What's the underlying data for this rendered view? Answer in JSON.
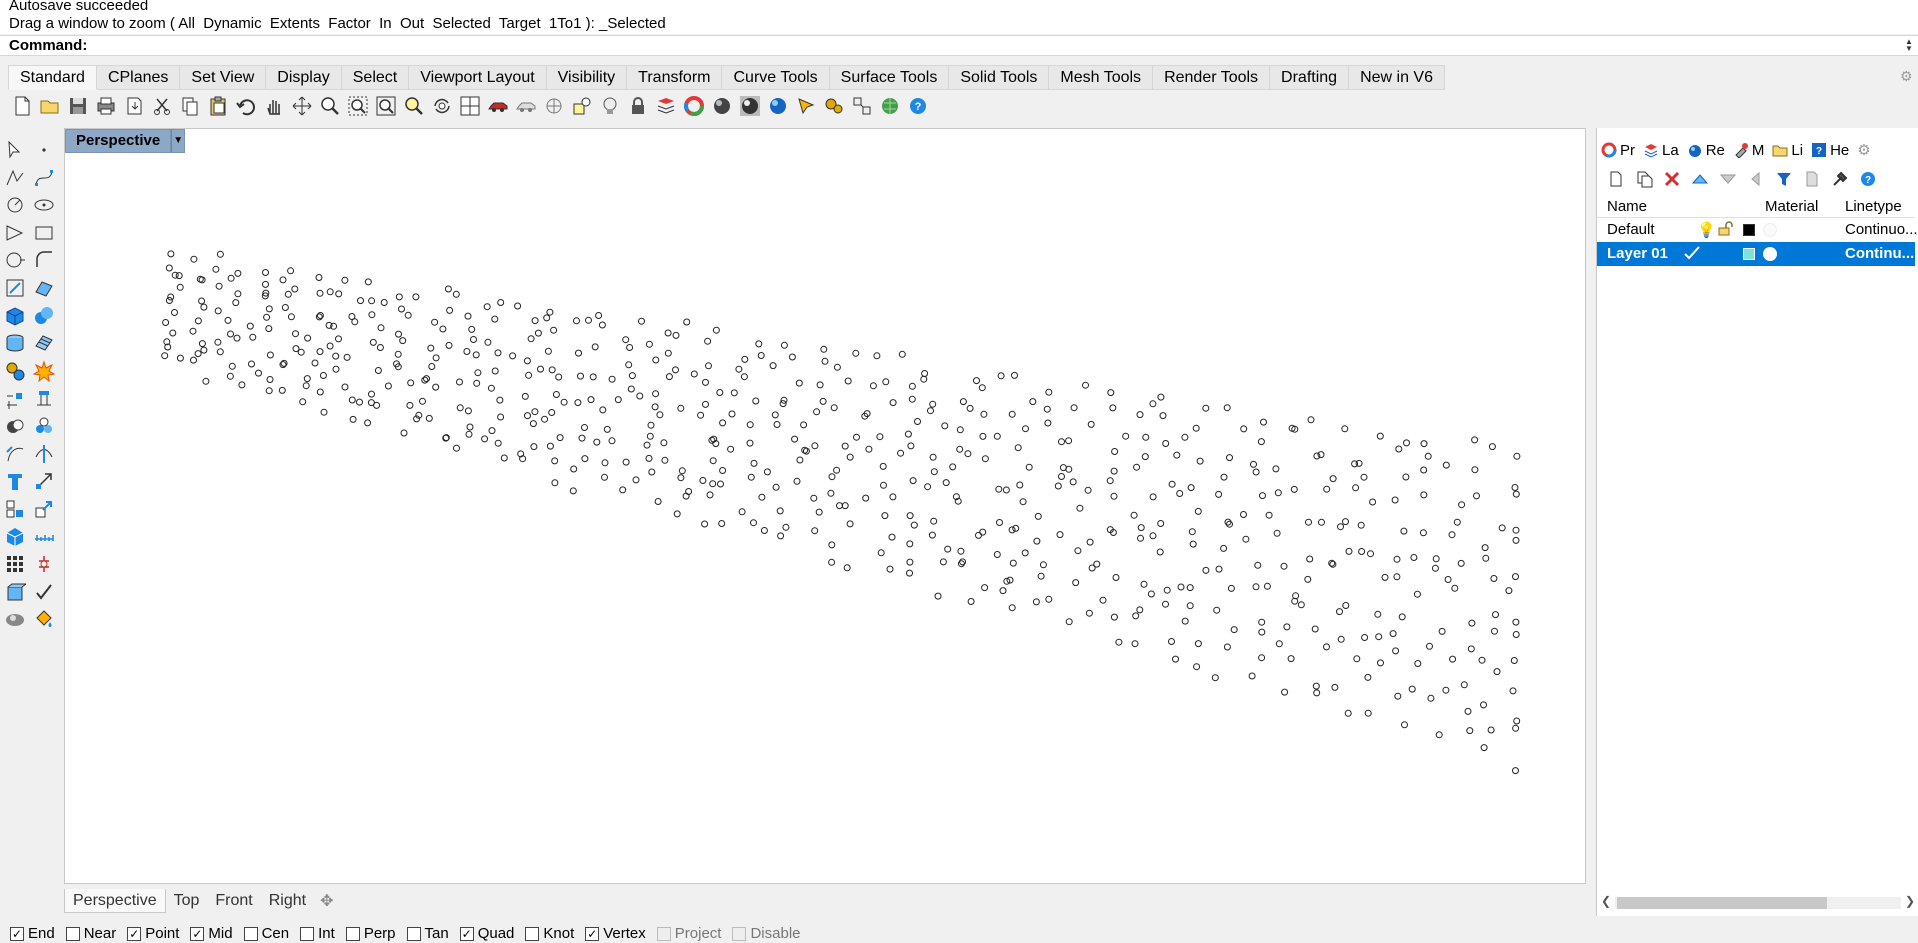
{
  "command": {
    "history": [
      "Autosave succeeded",
      "Drag a window to zoom ( All  Dynamic  Extents  Factor  In  Out  Selected  Target  1To1 ): _Selected"
    ],
    "prompt_label": "Command:",
    "input_value": ""
  },
  "tabs": [
    "Standard",
    "CPlanes",
    "Set View",
    "Display",
    "Select",
    "Viewport Layout",
    "Visibility",
    "Transform",
    "Curve Tools",
    "Surface Tools",
    "Solid Tools",
    "Mesh Tools",
    "Render Tools",
    "Drafting",
    "New in V6"
  ],
  "active_tab": "Standard",
  "viewport": {
    "title": "Perspective",
    "tabs": [
      "Perspective",
      "Top",
      "Front",
      "Right"
    ],
    "active": "Perspective"
  },
  "osnap": [
    {
      "label": "End",
      "checked": true
    },
    {
      "label": "Near",
      "checked": false
    },
    {
      "label": "Point",
      "checked": true
    },
    {
      "label": "Mid",
      "checked": true
    },
    {
      "label": "Cen",
      "checked": false
    },
    {
      "label": "Int",
      "checked": false
    },
    {
      "label": "Perp",
      "checked": false
    },
    {
      "label": "Tan",
      "checked": false
    },
    {
      "label": "Quad",
      "checked": true
    },
    {
      "label": "Knot",
      "checked": false
    },
    {
      "label": "Vertex",
      "checked": true
    },
    {
      "label": "Project",
      "checked": false,
      "disabled": true
    },
    {
      "label": "Disable",
      "checked": false,
      "disabled": true
    }
  ],
  "panel": {
    "tabs": [
      {
        "label": "Pr",
        "icon": "properties-icon"
      },
      {
        "label": "La",
        "icon": "layers-icon"
      },
      {
        "label": "Re",
        "icon": "render-icon"
      },
      {
        "label": "M",
        "icon": "materials-icon"
      },
      {
        "label": "Li",
        "icon": "libraries-icon"
      },
      {
        "label": "He",
        "icon": "help-icon"
      }
    ],
    "columns": {
      "name": "Name",
      "material": "Material",
      "linetype": "Linetype"
    },
    "layers": [
      {
        "name": "Default",
        "current": false,
        "color": "#000000",
        "linetype": "Continuo..."
      },
      {
        "name": "Layer 01",
        "current": true,
        "color": "#7fe0d8",
        "linetype": "Continu..."
      }
    ]
  },
  "colors": {
    "accent": "#0078d7",
    "viewport_label": "#8da7c7"
  }
}
